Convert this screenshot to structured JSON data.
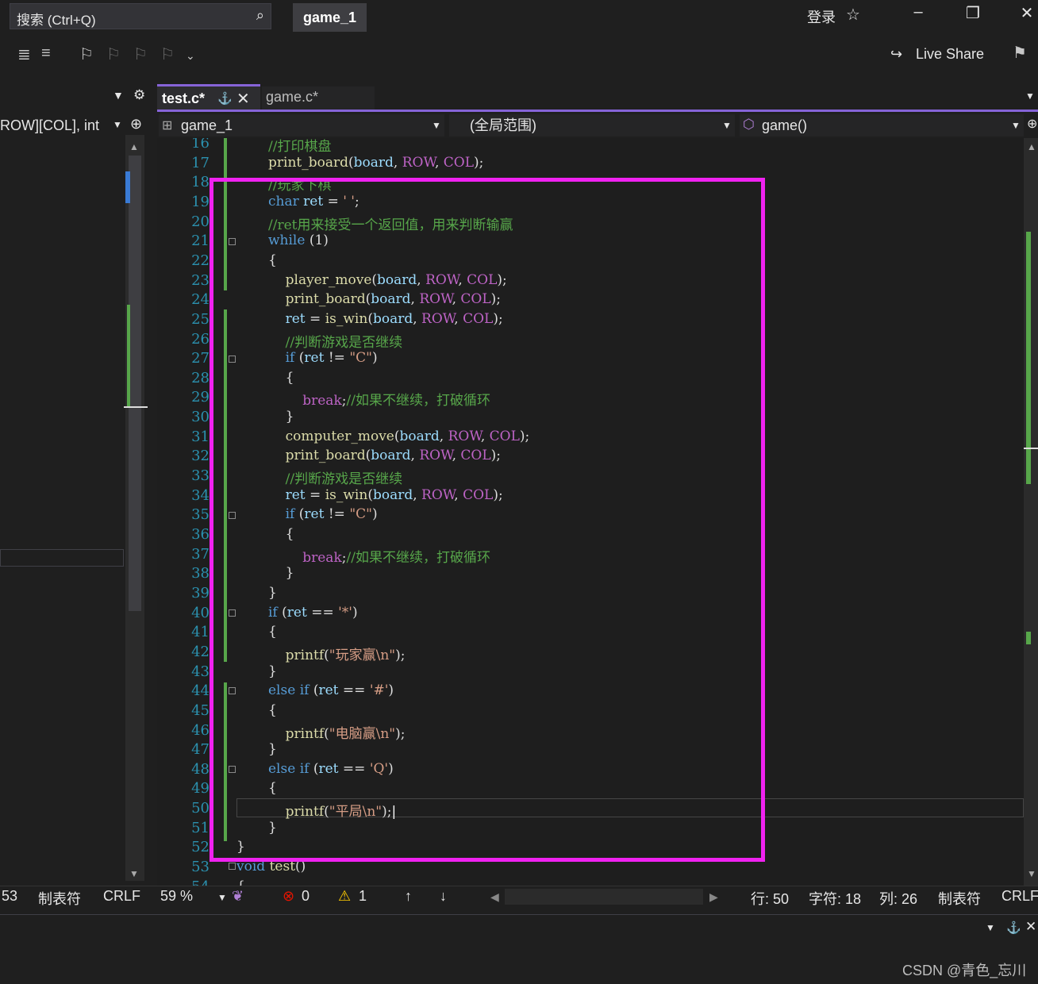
{
  "search": {
    "placeholder": "搜索 (Ctrl+Q)"
  },
  "solution_name": "game_1",
  "login_label": "登录",
  "live_share_label": "Live Share",
  "tabs": [
    {
      "label": "test.c*"
    },
    {
      "label": "game.c*"
    }
  ],
  "left_panel": {
    "dropdown_text": "ROW][COL], int"
  },
  "nav": {
    "project": "game_1",
    "scope": "(全局范围)",
    "member": "game()"
  },
  "code_lines": [
    {
      "n": "16",
      "html": "<span class='cm'>//打印棋盘</span>"
    },
    {
      "n": "17",
      "html": "<span class='fn'>print_board</span>(<span class='var'>board</span>, <span class='mac'>ROW</span>, <span class='mac'>COL</span>);"
    },
    {
      "n": "18",
      "html": "<span class='cm'>//玩家下棋</span>"
    },
    {
      "n": "19",
      "html": "<span class='kw'>char</span> <span class='var'>ret</span> = <span class='str'>' '</span>;"
    },
    {
      "n": "20",
      "html": "<span class='cm'>//ret用来接受一个返回值，用来判断输赢</span>"
    },
    {
      "n": "21",
      "html": "<span class='kw'>while</span> (1)"
    },
    {
      "n": "22",
      "html": "{"
    },
    {
      "n": "23",
      "html": "    <span class='fn'>player_move</span>(<span class='var'>board</span>, <span class='mac'>ROW</span>, <span class='mac'>COL</span>);"
    },
    {
      "n": "24",
      "html": "    <span class='fn'>print_board</span>(<span class='var'>board</span>, <span class='mac'>ROW</span>, <span class='mac'>COL</span>);"
    },
    {
      "n": "25",
      "html": "    <span class='var'>ret</span> = <span class='fn'>is_win</span>(<span class='var'>board</span>, <span class='mac'>ROW</span>, <span class='mac'>COL</span>);"
    },
    {
      "n": "26",
      "html": "    <span class='cm'>//判断游戏是否继续</span>"
    },
    {
      "n": "27",
      "html": "    <span class='kw'>if</span> (<span class='var'>ret</span> != <span class='str'>\"C\"</span>)"
    },
    {
      "n": "28",
      "html": "    {"
    },
    {
      "n": "29",
      "html": "        <span class='mac'>break</span>;<span class='cm'>//如果不继续，打破循环</span>"
    },
    {
      "n": "30",
      "html": "    }"
    },
    {
      "n": "31",
      "html": "    <span class='fn'>computer_move</span>(<span class='var'>board</span>, <span class='mac'>ROW</span>, <span class='mac'>COL</span>);"
    },
    {
      "n": "32",
      "html": "    <span class='fn'>print_board</span>(<span class='var'>board</span>, <span class='mac'>ROW</span>, <span class='mac'>COL</span>);"
    },
    {
      "n": "33",
      "html": "    <span class='cm'>//判断游戏是否继续</span>"
    },
    {
      "n": "34",
      "html": "    <span class='var'>ret</span> = <span class='fn'>is_win</span>(<span class='var'>board</span>, <span class='mac'>ROW</span>, <span class='mac'>COL</span>);"
    },
    {
      "n": "35",
      "html": "    <span class='kw'>if</span> (<span class='var'>ret</span> != <span class='str'>\"C\"</span>)"
    },
    {
      "n": "36",
      "html": "    {"
    },
    {
      "n": "37",
      "html": "        <span class='mac'>break</span>;<span class='cm'>//如果不继续，打破循环</span>"
    },
    {
      "n": "38",
      "html": "    }"
    },
    {
      "n": "39",
      "html": "}"
    },
    {
      "n": "40",
      "html": "<span class='kw'>if</span> (<span class='var'>ret</span> == <span class='str'>'*'</span>)"
    },
    {
      "n": "41",
      "html": "{"
    },
    {
      "n": "42",
      "html": "    <span class='fn'>printf</span>(<span class='str'>\"玩家赢\\n\"</span>);"
    },
    {
      "n": "43",
      "html": "}"
    },
    {
      "n": "44",
      "html": "<span class='kw'>else</span> <span class='kw'>if</span> (<span class='var'>ret</span> == <span class='str'>'#'</span>)"
    },
    {
      "n": "45",
      "html": "{"
    },
    {
      "n": "46",
      "html": "    <span class='fn'>printf</span>(<span class='str'>\"电脑赢\\n\"</span>);"
    },
    {
      "n": "47",
      "html": "}"
    },
    {
      "n": "48",
      "html": "<span class='kw'>else</span> <span class='kw'>if</span> (<span class='var'>ret</span> == <span class='str'>'Q'</span>)"
    },
    {
      "n": "49",
      "html": "{"
    },
    {
      "n": "50",
      "html": "    <span class='fn'>printf</span>(<span class='str'>\"平局\\n\"</span>);<span style='color:#fff'>|</span>"
    },
    {
      "n": "51",
      "html": "}"
    },
    {
      "n": "52",
      "html": "}"
    },
    {
      "n": "53",
      "html": "<span class='kw'>void</span> <span class='fn'>test</span>()"
    },
    {
      "n": "54",
      "html": "{"
    }
  ],
  "status": {
    "left_line": "53",
    "left_tabs": "制表符",
    "left_eol": "CRLF",
    "zoom": "59 %",
    "errors": "0",
    "warnings": "1",
    "row": "行: 50",
    "char": "字符: 18",
    "col": "列: 26",
    "tabs": "制表符",
    "eol": "CRLF"
  },
  "watermark": "CSDN @青色_忘川",
  "colors": {
    "accent": "#8664d8",
    "highlight": "#f022f0",
    "error": "#e51400",
    "warning": "#ffcc00"
  }
}
